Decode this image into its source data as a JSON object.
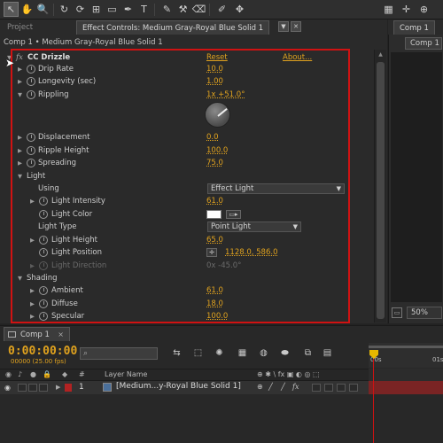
{
  "toolbar": {
    "tools": [
      {
        "icon": "selection-arrow-icon",
        "glyph": "↖"
      },
      {
        "icon": "hand-icon",
        "glyph": "✋"
      },
      {
        "icon": "zoom-icon",
        "glyph": "🔍"
      },
      {
        "icon": "rotate-icon",
        "glyph": "↻"
      },
      {
        "icon": "camera-orbit-icon",
        "glyph": "⟳"
      },
      {
        "icon": "pan-behind-icon",
        "glyph": "⊞"
      },
      {
        "icon": "rectangle-icon",
        "glyph": "▭"
      },
      {
        "icon": "pen-icon",
        "glyph": "✒"
      },
      {
        "icon": "text-icon",
        "glyph": "T"
      },
      {
        "icon": "brush-icon",
        "glyph": "✎"
      },
      {
        "icon": "clone-stamp-icon",
        "glyph": "⚒"
      },
      {
        "icon": "eraser-icon",
        "glyph": "⌫"
      },
      {
        "icon": "roto-brush-icon",
        "glyph": "✐"
      },
      {
        "icon": "puppet-pin-icon",
        "glyph": "✥"
      }
    ],
    "right_tools": [
      {
        "icon": "snapping-icon",
        "glyph": "▦"
      },
      {
        "icon": "axis-icon",
        "glyph": "✛"
      },
      {
        "icon": "workspace-icon",
        "glyph": "⊕"
      }
    ]
  },
  "tabs": {
    "project": "Project",
    "effect_controls": "Effect Controls: Medium Gray-Royal Blue Solid 1",
    "composition": "Comp 1"
  },
  "effect_panel": {
    "breadcrumb": "Comp 1 • Medium Gray-Royal Blue Solid 1",
    "fx_label": "fx",
    "effect_name": "CC Drizzle",
    "reset": "Reset",
    "about": "About...",
    "properties": {
      "drip_rate": {
        "label": "Drip Rate",
        "value": "10.0"
      },
      "longevity": {
        "label": "Longevity (sec)",
        "value": "1.00"
      },
      "rippling": {
        "label": "Rippling",
        "value": "1x +51.0°",
        "dial_degrees": 51
      },
      "displacement": {
        "label": "Displacement",
        "value": "0.0"
      },
      "ripple_height": {
        "label": "Ripple Height",
        "value": "100.0"
      },
      "spreading": {
        "label": "Spreading",
        "value": "75.0"
      },
      "light_group": {
        "label": "Light"
      },
      "using": {
        "label": "Using",
        "value": "Effect Light"
      },
      "light_intensity": {
        "label": "Light Intensity",
        "value": "61.0"
      },
      "light_color": {
        "label": "Light Color",
        "color": "#ffffff"
      },
      "light_type": {
        "label": "Light Type",
        "value": "Point Light"
      },
      "light_height": {
        "label": "Light Height",
        "value": "65.0"
      },
      "light_position": {
        "label": "Light Position",
        "value": "1128.0, 586.0"
      },
      "light_direction": {
        "label": "Light Direction",
        "value": "0x -45.0°"
      },
      "shading_group": {
        "label": "Shading"
      },
      "ambient": {
        "label": "Ambient",
        "value": "61.0"
      },
      "diffuse": {
        "label": "Diffuse",
        "value": "18.0"
      },
      "specular": {
        "label": "Specular",
        "value": "100.0"
      }
    }
  },
  "right_panel": {
    "comp_button": "Comp 1",
    "zoom": "50%"
  },
  "timeline": {
    "tab": "Comp 1",
    "close": "×",
    "timecode": "0:00:00:00",
    "fps": "00000 (25.00 fps)",
    "search_icon": "⌕",
    "ruler_start": "00s",
    "ruler_next": "01s",
    "header": {
      "layer_name": "Layer Name",
      "hash": "#",
      "switches": "⊕ ✱ \\ fx ▣ ◐ ◎ ⬚"
    },
    "layer": {
      "number": "1",
      "name": "[Medium...y-Royal Blue Solid 1]"
    }
  },
  "colors": {
    "accent_value": "#e0a21e",
    "highlight_box": "#d01212",
    "layer_label": "#b22222",
    "layer_bar": "#7a2424"
  }
}
